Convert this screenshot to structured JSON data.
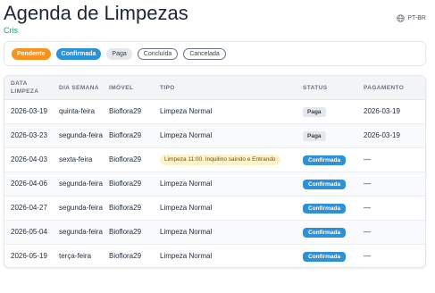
{
  "header": {
    "title": "Agenda de Limpezas",
    "user": "Cris",
    "locale": "PT-BR"
  },
  "filters": [
    {
      "label": "Pendente"
    },
    {
      "label": "Confirmada"
    },
    {
      "label": "Paga"
    },
    {
      "label": "Concluída"
    },
    {
      "label": "Cancelada"
    }
  ],
  "table": {
    "columns": [
      "Data Limpeza",
      "Dia Semana",
      "Imóvel",
      "Tipo",
      "Status",
      "Pagamento"
    ],
    "rows": [
      {
        "date": "2026-03-19",
        "weekday": "quinta-feira",
        "property": "Bioflora29",
        "type": "Limpeza Normal",
        "status": "Paga",
        "payment": "2026-03-19"
      },
      {
        "date": "2026-03-23",
        "weekday": "segunda-feira",
        "property": "Bioflora29",
        "type": "Limpeza Normal",
        "status": "Paga",
        "payment": "2026-03-19"
      },
      {
        "date": "2026-04-03",
        "weekday": "sexta-feira",
        "property": "Bioflora29",
        "type": "Limpeza 11:00. Inquilino saindo e Entrando",
        "status": "Confirmada",
        "payment": "—"
      },
      {
        "date": "2026-04-06",
        "weekday": "segunda-feira",
        "property": "Bioflora29",
        "type": "Limpeza Normal",
        "status": "Confirmada",
        "payment": "—"
      },
      {
        "date": "2026-04-27",
        "weekday": "segunda-feira",
        "property": "Bioflora29",
        "type": "Limpeza Normal",
        "status": "Confirmada",
        "payment": "—"
      },
      {
        "date": "2026-05-04",
        "weekday": "segunda-feira",
        "property": "Bioflora29",
        "type": "Limpeza Normal",
        "status": "Confirmada",
        "payment": "—"
      },
      {
        "date": "2026-05-19",
        "weekday": "terça-feira",
        "property": "Bioflora29",
        "type": "Limpeza Normal",
        "status": "Confirmada",
        "payment": "—"
      }
    ]
  },
  "colors": {
    "pendente": "#f7921e",
    "confirmada": "#2b91d9",
    "paga": "#e5e7eb",
    "user": "#22a36a",
    "note": "#fdf3c8"
  }
}
